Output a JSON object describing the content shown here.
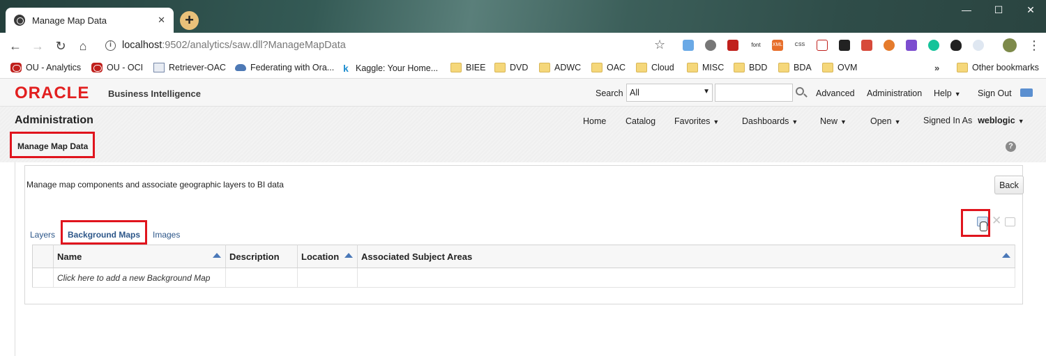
{
  "browser": {
    "tab_title": "Manage Map Data",
    "url_host": "localhost",
    "url_rest": ":9502/analytics/saw.dll?ManageMapData",
    "bookmarks": [
      {
        "label": "OU - Analytics",
        "icon": "oracle"
      },
      {
        "label": "OU - OCI",
        "icon": "oracle"
      },
      {
        "label": "Retriever-OAC",
        "icon": "page"
      },
      {
        "label": "Federating with Ora...",
        "icon": "cloud"
      },
      {
        "label": "Kaggle: Your Home...",
        "icon": "kaggle"
      },
      {
        "label": "BIEE",
        "icon": "folder"
      },
      {
        "label": "DVD",
        "icon": "folder"
      },
      {
        "label": "ADWC",
        "icon": "folder"
      },
      {
        "label": "OAC",
        "icon": "folder"
      },
      {
        "label": "Cloud",
        "icon": "folder"
      },
      {
        "label": "MISC",
        "icon": "folder"
      },
      {
        "label": "BDD",
        "icon": "folder"
      },
      {
        "label": "BDA",
        "icon": "folder"
      },
      {
        "label": "OVM",
        "icon": "folder"
      }
    ],
    "bookmarks_more": "»",
    "other_bookmarks": "Other bookmarks",
    "extensions": [
      "font",
      "XML",
      "CSS"
    ]
  },
  "header": {
    "logo": "ORACLE",
    "product": "Business Intelligence",
    "search_label": "Search",
    "search_scope": "All",
    "search_placeholder": "",
    "advanced": "Advanced",
    "administration": "Administration",
    "help": "Help",
    "sign_out": "Sign Out"
  },
  "admin_bar": {
    "title": "Administration",
    "nav": {
      "home": "Home",
      "catalog": "Catalog",
      "favorites": "Favorites",
      "dashboards": "Dashboards",
      "new": "New",
      "open": "Open",
      "signed_in_as": "Signed In As",
      "user": "weblogic"
    },
    "page": "Manage Map Data"
  },
  "main": {
    "intro": "Manage map components and associate geographic layers to BI data",
    "back": "Back",
    "tabs": [
      {
        "label": "Layers",
        "active": false
      },
      {
        "label": "Background Maps",
        "active": true
      },
      {
        "label": "Images",
        "active": false
      }
    ],
    "columns": [
      "Name",
      "Description",
      "Location",
      "Associated Subject Areas"
    ],
    "add_row": "Click here to add a new Background Map"
  },
  "colors": {
    "highlight": "#e0141d",
    "oracle_red": "#e21f1f",
    "link": "#2c5689"
  }
}
